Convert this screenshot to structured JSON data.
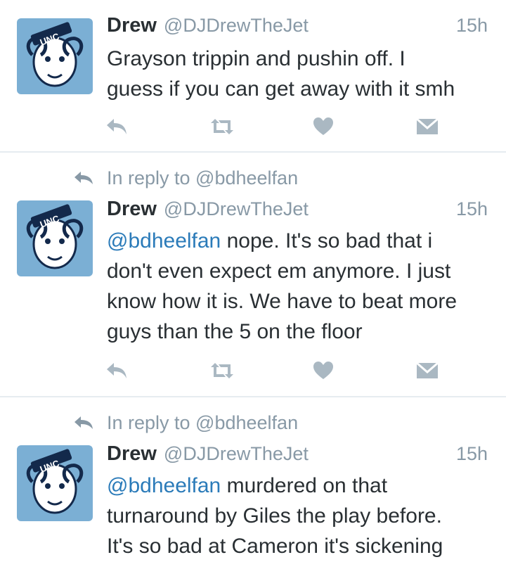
{
  "tweets": [
    {
      "name": "Drew",
      "handle": "@DJDrewTheJet",
      "time": "15h",
      "in_reply_to": "",
      "mention": "",
      "text": "Grayson trippin and pushin off. I\nguess if you can get away with it smh"
    },
    {
      "name": "Drew",
      "handle": "@DJDrewTheJet",
      "time": "15h",
      "in_reply_to": "In reply to @bdheelfan",
      "mention": "@bdheelfan",
      "text": " nope. It's so bad that i\ndon't even expect em anymore. I just\nknow how it is. We have to beat more\nguys than the 5 on the floor"
    },
    {
      "name": "Drew",
      "handle": "@DJDrewTheJet",
      "time": "15h",
      "in_reply_to": "In reply to @bdheelfan",
      "mention": "@bdheelfan",
      "text": " murdered on that\nturnaround by Giles the play before.\nIt's so bad at Cameron it's sickening"
    }
  ],
  "avatar": {
    "logo_text": "UNC",
    "bg_color": "#7BAFD4"
  },
  "icons": [
    "reply-icon",
    "retweet-icon",
    "like-icon",
    "direct-message-icon"
  ],
  "colors": {
    "icon": "#aab8c2",
    "muted": "#8899a6",
    "mention": "#2b7bb9",
    "text": "#292f33"
  }
}
